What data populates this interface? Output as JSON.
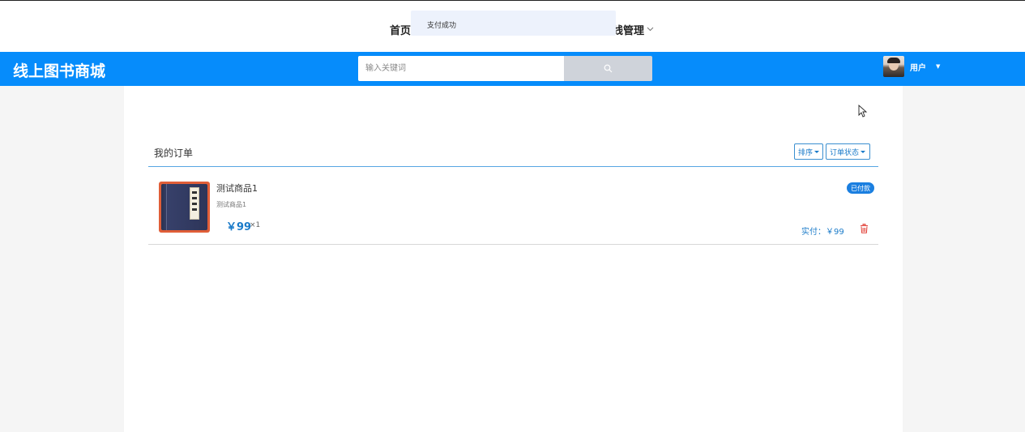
{
  "topnav": {
    "home_label": "首页",
    "admin_label": "线管理",
    "chevron_icon": "chevron-down-icon"
  },
  "toast": {
    "message": "支付成功"
  },
  "header": {
    "logo": "线上图书商城",
    "search_placeholder": "输入关键词",
    "search_icon": "search-icon",
    "user_name": "用户",
    "brand_color": "#068cfb"
  },
  "orders": {
    "title": "我的订单",
    "sort_label": "排序",
    "status_filter_label": "订单状态",
    "items": [
      {
        "name": "测试商品1",
        "description": "测试商品1",
        "price": "￥99",
        "quantity": "×1",
        "status": "已付款",
        "paid_label": "实付：￥99"
      }
    ]
  }
}
